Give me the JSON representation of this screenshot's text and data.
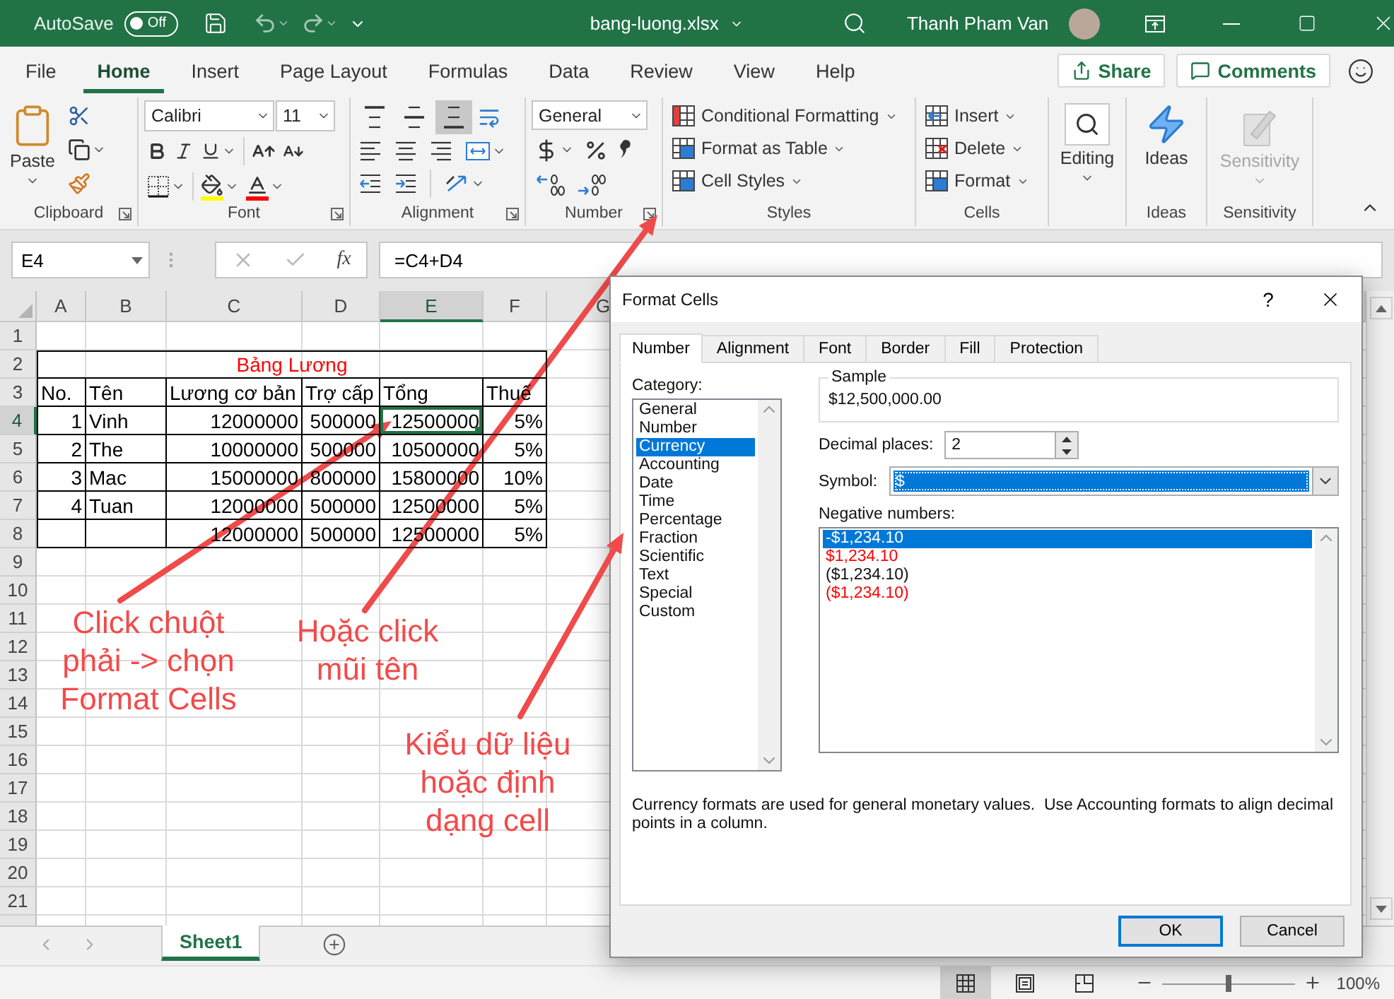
{
  "title_bar": {
    "autosave_label": "AutoSave",
    "autosave": {
      "on": false,
      "label": "Off"
    },
    "file_name": "bang-luong.xlsx",
    "user_name": "Thanh Pham Van"
  },
  "menu_tabs": [
    {
      "label": "File",
      "selected": false
    },
    {
      "label": "Home",
      "selected": true
    },
    {
      "label": "Insert",
      "selected": false
    },
    {
      "label": "Page Layout",
      "selected": false
    },
    {
      "label": "Formulas",
      "selected": false
    },
    {
      "label": "Data",
      "selected": false
    },
    {
      "label": "Review",
      "selected": false
    },
    {
      "label": "View",
      "selected": false
    },
    {
      "label": "Help",
      "selected": false
    }
  ],
  "share_button": "Share",
  "comments_button": "Comments",
  "ribbon": {
    "clipboard": {
      "paste": "Paste",
      "label": "Clipboard"
    },
    "font": {
      "font_name": "Calibri",
      "font_size": "11",
      "label": "Font"
    },
    "alignment": {
      "label": "Alignment",
      "buttons": [
        {
          "kind": "top",
          "selected": false
        },
        {
          "kind": "middle",
          "selected": false
        },
        {
          "kind": "bottom",
          "selected": true
        }
      ]
    },
    "number": {
      "format": "General",
      "label": "Number"
    },
    "styles": {
      "items": [
        "Conditional Formatting",
        "Format as Table",
        "Cell Styles"
      ],
      "label": "Styles"
    },
    "cells": {
      "items": [
        "Insert",
        "Delete",
        "Format"
      ],
      "label": "Cells"
    },
    "editing": {
      "button": "Editing"
    },
    "ideas": {
      "button": "Ideas",
      "label": "Ideas"
    },
    "sensitivity": {
      "button": "Sensitivity",
      "label": "Sensitivity",
      "disabled": true
    }
  },
  "formula_bar": {
    "name_box": "E4",
    "function_label": "fx",
    "formula": "=C4+D4"
  },
  "sheet": {
    "columns": [
      {
        "label": "A",
        "selected": false
      },
      {
        "label": "B",
        "selected": false
      },
      {
        "label": "C",
        "selected": false
      },
      {
        "label": "D",
        "selected": false
      },
      {
        "label": "E",
        "selected": true
      },
      {
        "label": "F",
        "selected": false
      },
      {
        "label": "G",
        "selected": false
      }
    ],
    "row_numbers": [
      {
        "label": "1",
        "selected": false
      },
      {
        "label": "2",
        "selected": false
      },
      {
        "label": "3",
        "selected": false
      },
      {
        "label": "4",
        "selected": true
      },
      {
        "label": "5",
        "selected": false
      },
      {
        "label": "6",
        "selected": false
      },
      {
        "label": "7",
        "selected": false
      },
      {
        "label": "8",
        "selected": false
      },
      {
        "label": "9",
        "selected": false
      },
      {
        "label": "10",
        "selected": false
      },
      {
        "label": "11",
        "selected": false
      },
      {
        "label": "12",
        "selected": false
      },
      {
        "label": "13",
        "selected": false
      },
      {
        "label": "14",
        "selected": false
      },
      {
        "label": "15",
        "selected": false
      },
      {
        "label": "16",
        "selected": false
      },
      {
        "label": "17",
        "selected": false
      },
      {
        "label": "18",
        "selected": false
      },
      {
        "label": "19",
        "selected": false
      },
      {
        "label": "20",
        "selected": false
      },
      {
        "label": "21",
        "selected": false
      }
    ],
    "title": "Bảng Lương",
    "header": [
      "No.",
      "Tên",
      "Lương cơ bản",
      "Trợ cấp",
      "Tổng",
      "Thuế"
    ],
    "rows": [
      {
        "cells": [
          {
            "text": "1",
            "selected": false
          },
          {
            "text": "Vinh",
            "selected": false
          },
          {
            "text": "12000000",
            "selected": false
          },
          {
            "text": "500000",
            "selected": false
          },
          {
            "text": "12500000",
            "selected": true
          },
          {
            "text": "5%",
            "selected": false
          }
        ]
      },
      {
        "cells": [
          {
            "text": "2",
            "selected": false
          },
          {
            "text": "The",
            "selected": false
          },
          {
            "text": "10000000",
            "selected": false
          },
          {
            "text": "500000",
            "selected": false
          },
          {
            "text": "10500000",
            "selected": false
          },
          {
            "text": "5%",
            "selected": false
          }
        ]
      },
      {
        "cells": [
          {
            "text": "3",
            "selected": false
          },
          {
            "text": "Mac",
            "selected": false
          },
          {
            "text": "15000000",
            "selected": false
          },
          {
            "text": "800000",
            "selected": false
          },
          {
            "text": "15800000",
            "selected": false
          },
          {
            "text": "10%",
            "selected": false
          }
        ]
      },
      {
        "cells": [
          {
            "text": "4",
            "selected": false
          },
          {
            "text": "Tuan",
            "selected": false
          },
          {
            "text": "12000000",
            "selected": false
          },
          {
            "text": "500000",
            "selected": false
          },
          {
            "text": "12500000",
            "selected": false
          },
          {
            "text": "5%",
            "selected": false
          }
        ]
      },
      {
        "cells": [
          {
            "selected": false
          },
          {
            "selected": false
          },
          {
            "text": "12000000",
            "selected": false
          },
          {
            "text": "500000",
            "selected": false
          },
          {
            "text": "12500000",
            "selected": false
          },
          {
            "text": "5%",
            "selected": false
          }
        ]
      }
    ]
  },
  "annotations": [
    {
      "text": "Click chuột\nphải -> chọn\nFormat Cells"
    },
    {
      "text": "Hoặc click\nmũi tên"
    },
    {
      "text": "Kiểu dữ liệu\nhoặc định\ndạng cell"
    }
  ],
  "sheet_tabs": [
    {
      "label": "Sheet1",
      "selected": true
    }
  ],
  "status_bar": {
    "views": [
      {
        "kind": "normal",
        "selected": true
      },
      {
        "kind": "page_layout",
        "selected": false
      },
      {
        "kind": "page_break",
        "selected": false
      }
    ],
    "zoom_slider": {
      "level": 0.5
    },
    "zoom": "100%"
  },
  "dialog": {
    "title": "Format Cells",
    "help": "?",
    "tabs": [
      {
        "label": "Number",
        "selected": true
      },
      {
        "label": "Alignment",
        "selected": false
      },
      {
        "label": "Font",
        "selected": false
      },
      {
        "label": "Border",
        "selected": false
      },
      {
        "label": "Fill",
        "selected": false
      },
      {
        "label": "Protection",
        "selected": false
      }
    ],
    "category_label": "Category:",
    "categories": [
      {
        "label": "General",
        "selected": false
      },
      {
        "label": "Number",
        "selected": false
      },
      {
        "label": "Currency",
        "selected": true
      },
      {
        "label": "Accounting",
        "selected": false
      },
      {
        "label": "Date",
        "selected": false
      },
      {
        "label": "Time",
        "selected": false
      },
      {
        "label": "Percentage",
        "selected": false
      },
      {
        "label": "Fraction",
        "selected": false
      },
      {
        "label": "Scientific",
        "selected": false
      },
      {
        "label": "Text",
        "selected": false
      },
      {
        "label": "Special",
        "selected": false
      },
      {
        "label": "Custom",
        "selected": false
      }
    ],
    "sample_label": "Sample",
    "sample_value": "$12,500,000.00",
    "decimal_label": "Decimal places:",
    "decimal_value": "2",
    "symbol_label": "Symbol:",
    "symbol_value": "$",
    "negative_label": "Negative numbers:",
    "negative_formats": [
      {
        "label": "-$1,234.10",
        "red": false,
        "selected": true
      },
      {
        "label": "$1,234.10",
        "red": true,
        "selected": false
      },
      {
        "label": "($1,234.10)",
        "red": false,
        "selected": false
      },
      {
        "label": "($1,234.10)",
        "red": true,
        "selected": false
      }
    ],
    "description": "Currency formats are used for general monetary values.  Use Accounting formats to align decimal points in a column.",
    "buttons": [
      {
        "label": "OK",
        "default": true
      },
      {
        "label": "Cancel",
        "default": false
      }
    ]
  }
}
